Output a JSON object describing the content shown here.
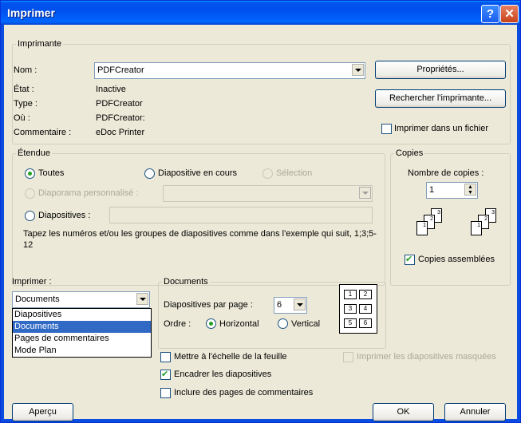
{
  "window": {
    "title": "Imprimer",
    "help_glyph": "?",
    "close_glyph": "✕"
  },
  "imprimante": {
    "legend": "Imprimante",
    "nom_label": "Nom :",
    "nom_value": "PDFCreator",
    "etat_label": "État :",
    "etat_value": "Inactive",
    "type_label": "Type :",
    "type_value": "PDFCreator",
    "ou_label": "Où :",
    "ou_value": "PDFCreator:",
    "commentaire_label": "Commentaire :",
    "commentaire_value": "eDoc Printer",
    "proprietes_btn": "Propriétés...",
    "rechercher_btn": "Rechercher l'imprimante...",
    "fichier_label": "Imprimer dans un fichier"
  },
  "etendue": {
    "legend": "Étendue",
    "toutes": "Toutes",
    "diapositive_en_cours": "Diapositive en cours",
    "selection": "Sélection",
    "diaporama": "Diaporama personnalisé :",
    "diapositives": "Diapositives :",
    "hint": "Tapez les numéros et/ou les groupes de diapositives comme dans l'exemple qui suit, 1;3;5-12"
  },
  "copies": {
    "legend": "Copies",
    "nombre_label": "Nombre de copies :",
    "nombre_value": "1",
    "assemblees_label": "Copies assemblées",
    "sheets": [
      "1",
      "2",
      "3",
      "1",
      "2",
      "3"
    ]
  },
  "imprimer": {
    "label": "Imprimer :",
    "value": "Documents",
    "options": [
      "Diapositives",
      "Documents",
      "Pages de commentaires",
      "Mode Plan"
    ],
    "selected_index": 1
  },
  "documents": {
    "legend": "Documents",
    "par_page_label": "Diapositives par page :",
    "par_page_value": "6",
    "ordre_label": "Ordre :",
    "horizontal": "Horizontal",
    "vertical": "Vertical",
    "preview_numbers": [
      "1",
      "2",
      "3",
      "4",
      "5",
      "6"
    ]
  },
  "options": {
    "echelle": "Mettre à l'échelle de la feuille",
    "masquees": "Imprimer les diapositives masquées",
    "encadrer": "Encadrer les diapositives",
    "commentaires": "Inclure des pages de commentaires"
  },
  "footer": {
    "apercu": "Aperçu",
    "ok": "OK",
    "annuler": "Annuler"
  }
}
